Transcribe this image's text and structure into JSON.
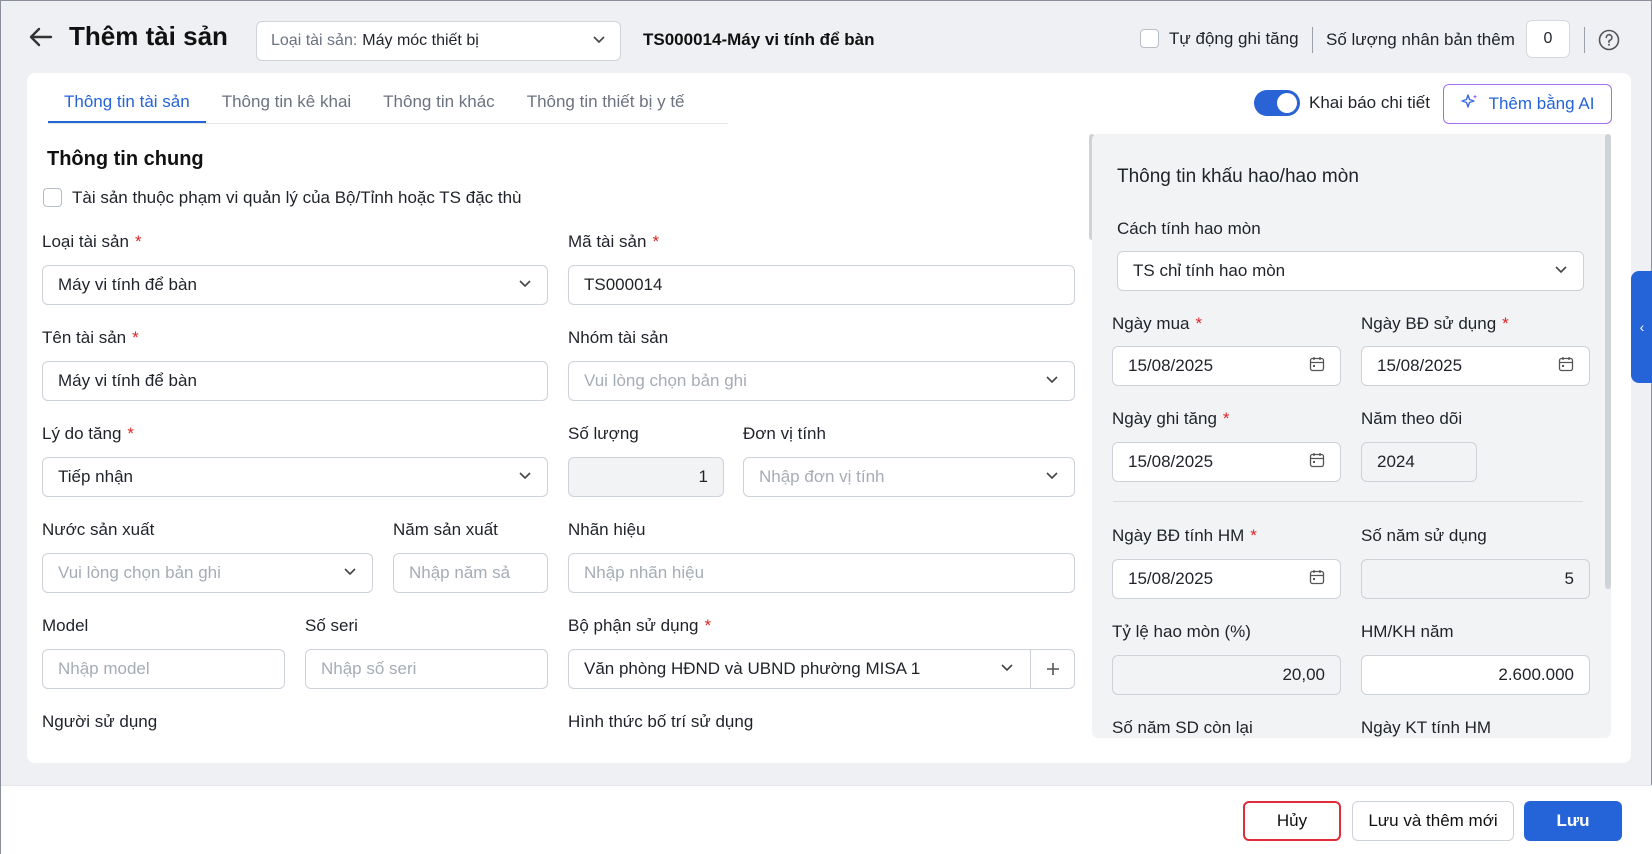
{
  "header": {
    "title": "Thêm tài sản",
    "type_prefix": "Loại tài sản:",
    "type_value": "Máy móc thiết bị",
    "asset_title": "TS000014-Máy vi tính để bàn",
    "auto_increase_label": "Tự động ghi tăng",
    "clone_qty_label": "Số lượng nhân bản thêm",
    "clone_qty_value": "0"
  },
  "tabs": [
    {
      "label": "Thông tin tài sản",
      "active": true
    },
    {
      "label": "Thông tin kê khai",
      "active": false
    },
    {
      "label": "Thông tin khác",
      "active": false
    },
    {
      "label": "Thông tin thiết bị y tế",
      "active": false
    }
  ],
  "toolbar": {
    "detail_toggle_label": "Khai báo chi tiết",
    "ai_button_label": "Thêm bằng AI"
  },
  "general": {
    "title": "Thông tin chung",
    "scope_label": "Tài sản thuộc phạm vi quản lý của Bộ/Tỉnh hoặc TS đặc thù",
    "asset_type_label": "Loại tài sản",
    "asset_type_value": "Máy vi tính để bàn",
    "asset_code_label": "Mã tài sản",
    "asset_code_value": "TS000014",
    "asset_name_label": "Tên tài sản",
    "asset_name_value": "Máy vi tính để bàn",
    "asset_group_label": "Nhóm tài sản",
    "asset_group_placeholder": "Vui lòng chọn bản ghi",
    "reason_label": "Lý do tăng",
    "reason_value": "Tiếp nhận",
    "quantity_label": "Số lượng",
    "quantity_value": "1",
    "unit_label": "Đơn vị tính",
    "unit_placeholder": "Nhập đơn vị tính",
    "country_label": "Nước sản xuất",
    "country_placeholder": "Vui lòng chọn bản ghi",
    "year_label": "Năm sản xuất",
    "year_placeholder": "Nhập năm sả",
    "brand_label": "Nhãn hiệu",
    "brand_placeholder": "Nhập nhãn hiệu",
    "model_label": "Model",
    "model_placeholder": "Nhập model",
    "serial_label": "Số seri",
    "serial_placeholder": "Nhập số seri",
    "dept_label": "Bộ phận sử dụng",
    "dept_value": "Văn phòng HĐND và UBND phường MISA 1",
    "user_label": "Người sử dụng",
    "usage_label": "Hình thức bố trí sử dụng"
  },
  "depreciation": {
    "title": "Thông tin khấu hao/hao mòn",
    "method_label": "Cách tính hao mòn",
    "method_value": "TS chỉ tính hao mòn",
    "purchase_date_label": "Ngày mua",
    "purchase_date_value": "15/08/2025",
    "start_use_label": "Ngày BĐ sử dụng",
    "start_use_value": "15/08/2025",
    "record_date_label": "Ngày ghi tăng",
    "record_date_value": "15/08/2025",
    "track_year_label": "Năm theo dõi",
    "track_year_value": "2024",
    "start_dep_label": "Ngày BĐ tính HM",
    "start_dep_value": "15/08/2025",
    "years_use_label": "Số năm sử dụng",
    "years_use_value": "5",
    "rate_label": "Tỷ lệ hao mòn (%)",
    "rate_value": "20,00",
    "annual_label": "HM/KH năm",
    "annual_value": "2.600.000",
    "remain_label": "Số năm SD còn lại",
    "end_dep_label": "Ngày KT tính HM"
  },
  "footer": {
    "cancel_label": "Hủy",
    "save_new_label": "Lưu và thêm mới",
    "save_label": "Lưu"
  },
  "colors": {
    "primary": "#2563d9",
    "required": "#e02424",
    "cancel_border": "#e02b3a"
  }
}
